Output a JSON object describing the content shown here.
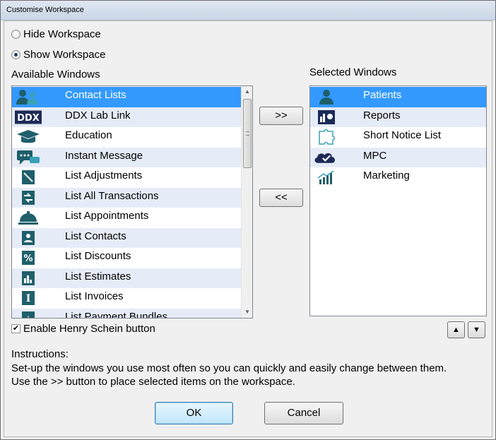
{
  "window": {
    "title": "Customise Workspace"
  },
  "workspace_options": {
    "hide_label": "Hide Workspace",
    "show_label": "Show Workspace",
    "selected": "show"
  },
  "available": {
    "heading": "Available Windows",
    "items": [
      {
        "label": "Contact Lists",
        "icon": "contacts-icon"
      },
      {
        "label": "DDX Lab Link",
        "icon": "ddx-logo-icon"
      },
      {
        "label": "Education",
        "icon": "graduation-cap-icon"
      },
      {
        "label": "Instant Message",
        "icon": "chat-bubbles-icon"
      },
      {
        "label": "List Adjustments",
        "icon": "adjustments-icon"
      },
      {
        "label": "List All Transactions",
        "icon": "transactions-icon"
      },
      {
        "label": "List Appointments",
        "icon": "service-bell-icon"
      },
      {
        "label": "List Contacts",
        "icon": "contact-card-icon"
      },
      {
        "label": "List Discounts",
        "icon": "percent-icon"
      },
      {
        "label": "List Estimates",
        "icon": "bar-chart-icon"
      },
      {
        "label": "List Invoices",
        "icon": "invoice-icon"
      },
      {
        "label": "List Payment Bundles",
        "icon": "payment-bundle-icon"
      }
    ],
    "selected_index": 0
  },
  "selected_windows": {
    "heading": "Selected Windows",
    "items": [
      {
        "label": "Patients",
        "icon": "person-icon"
      },
      {
        "label": "Reports",
        "icon": "report-chart-icon"
      },
      {
        "label": "Short Notice List",
        "icon": "puzzle-icon"
      },
      {
        "label": "MPC",
        "icon": "cloud-check-icon"
      },
      {
        "label": "Marketing",
        "icon": "growth-chart-icon"
      }
    ],
    "selected_index": 0
  },
  "buttons": {
    "add": ">>",
    "remove": "<<",
    "move_up": "up-arrow-icon",
    "move_down": "down-arrow-icon",
    "ok": "OK",
    "cancel": "Cancel"
  },
  "henry_schein": {
    "label": "Enable Henry Schein button",
    "checked": true
  },
  "instructions": {
    "heading": "Instructions:",
    "line1": "Set-up the windows you use most often so you can quickly and easily change between them.",
    "line2": "Use the >> button to place selected items on the workspace."
  },
  "colors": {
    "selection": "#3399ff",
    "alt_row": "#e6ecf7",
    "icon_teal": "#1f5f6b",
    "icon_navy": "#1c2a57"
  }
}
